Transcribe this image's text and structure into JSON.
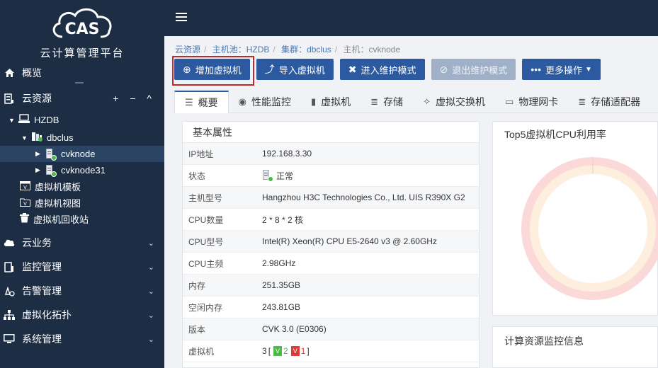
{
  "sidebar": {
    "app_title": "云计算管理平台",
    "logo_text": "CAS",
    "items": [
      {
        "label": "概览"
      },
      {
        "label": "云资源",
        "controls": "+ − ^"
      },
      {
        "label": "云业务"
      },
      {
        "label": "监控管理"
      },
      {
        "label": "告警管理"
      },
      {
        "label": "虚拟化拓扑"
      },
      {
        "label": "系统管理"
      }
    ],
    "tree": {
      "pool": "HZDB",
      "cluster": "dbclus",
      "hosts": [
        "cvknode",
        "cvknode31"
      ],
      "extras": [
        "虚拟机模板",
        "虚拟机视图",
        "虚拟机回收站"
      ]
    }
  },
  "breadcrumb": [
    "云资源",
    "主机池：HZDB",
    "集群：dbclus",
    "主机：cvknode"
  ],
  "toolbar": {
    "add_vm": "增加虚拟机",
    "import_vm": "导入虚拟机",
    "enter_maint": "进入维护模式",
    "exit_maint": "退出维护模式",
    "more": "更多操作"
  },
  "tabs": [
    "概要",
    "性能监控",
    "虚拟机",
    "存储",
    "虚拟交换机",
    "物理网卡",
    "存储适配器"
  ],
  "basic": {
    "title": "基本属性",
    "rows": [
      {
        "k": "IP地址",
        "v": "192.168.3.30"
      },
      {
        "k": "状态",
        "v": "正常"
      },
      {
        "k": "主机型号",
        "v": "Hangzhou H3C Technologies Co., Ltd. UIS R390X G2"
      },
      {
        "k": "CPU数量",
        "v": "2 * 8 * 2 核"
      },
      {
        "k": "CPU型号",
        "v": "Intel(R) Xeon(R) CPU E5-2640 v3 @ 2.60GHz"
      },
      {
        "k": "CPU主频",
        "v": "2.98GHz"
      },
      {
        "k": "内存",
        "v": "251.35GB"
      },
      {
        "k": "空闲内存",
        "v": "243.81GB"
      },
      {
        "k": "版本",
        "v": "CVK 3.0 (E0306)"
      },
      {
        "k": "虚拟机",
        "v": ""
      }
    ],
    "vm_total": "3",
    "vm_running": "2",
    "vm_stopped": "1",
    "bracket_open": "[",
    "bracket_close": "]"
  },
  "cpu_panel": {
    "title": "Top5虚拟机CPU利用率"
  },
  "compute_panel": {
    "title": "计算资源监控信息"
  },
  "colors": {
    "sidebar": "#1c2d44",
    "accent": "#2c5aa0",
    "highlight": "#c0282b",
    "ok": "#4cb848"
  }
}
